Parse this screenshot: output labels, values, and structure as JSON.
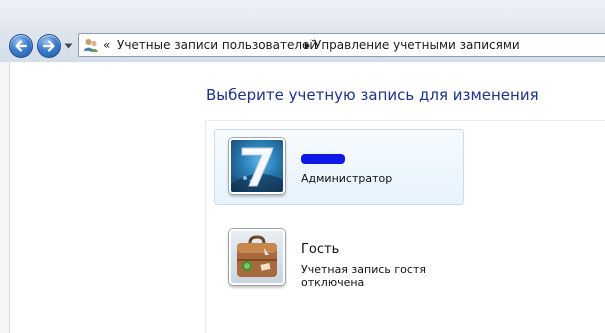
{
  "address_bar": {
    "overflow_chevron": "«",
    "breadcrumbs": [
      {
        "label": "Учетные записи пользователей"
      },
      {
        "label": "Управление учетными записями"
      }
    ]
  },
  "main": {
    "heading": "Выберите учетную запись для изменения",
    "accounts": [
      {
        "name": "",
        "name_redacted": true,
        "role": "Администратор",
        "icon": "windows7-logo-icon",
        "hover": true
      },
      {
        "name": "Гость",
        "role": "Учетная запись гостя отключена",
        "icon": "suitcase-icon",
        "hover": false
      }
    ]
  },
  "colors": {
    "heading": "#1e3287",
    "redaction": "#1018e6",
    "tile_hover": "#e8f3fc"
  }
}
